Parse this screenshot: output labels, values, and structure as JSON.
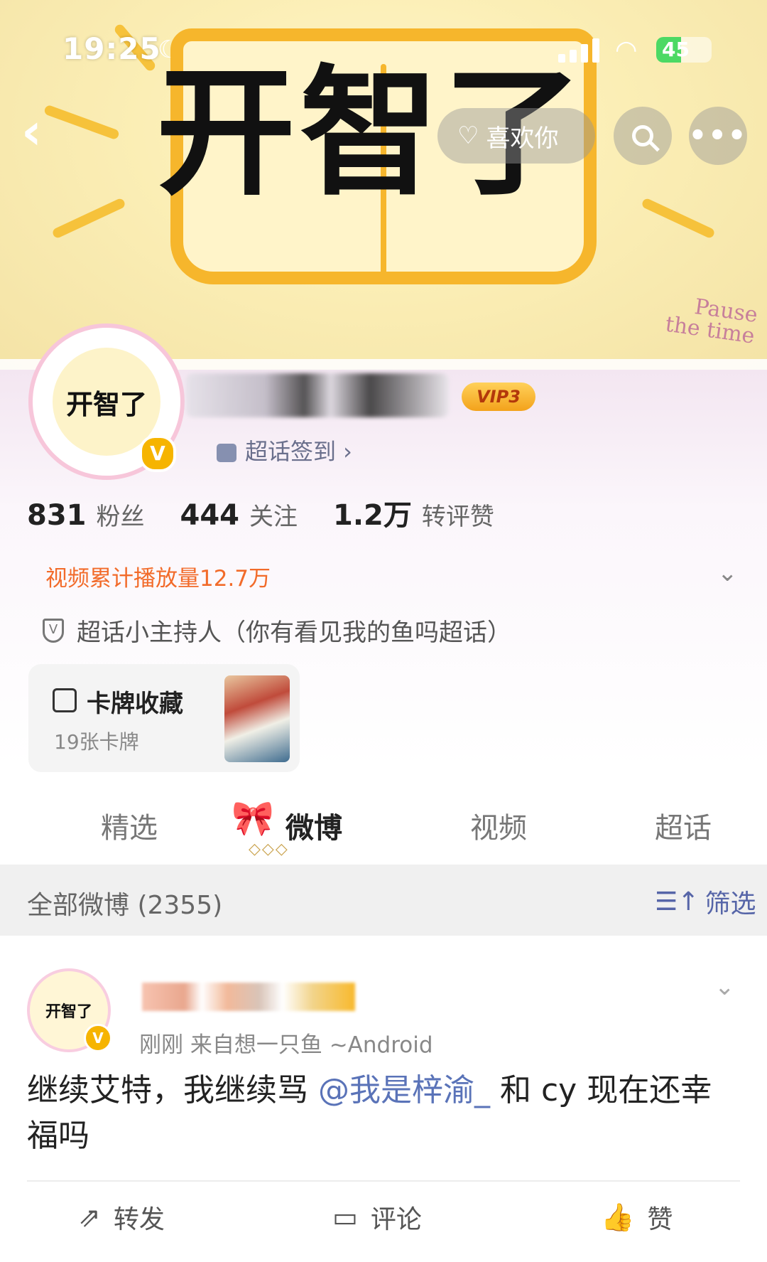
{
  "status_bar": {
    "time": "19:25",
    "battery": "45",
    "battery_level": 0.45
  },
  "banner": {
    "title": "开智了",
    "decoration_text": "Pause the time"
  },
  "nav": {
    "back_icon": "chevron-left-icon",
    "like_label": "喜欢你",
    "search_icon": "search-icon",
    "more_label": "•••"
  },
  "profile": {
    "avatar_text": "开智了",
    "vip_label": "VIP3",
    "checkin_label": "超话签到 ›",
    "stats": [
      {
        "num": "831",
        "label": "粉丝"
      },
      {
        "num": "444",
        "label": "关注"
      },
      {
        "num": "1.2万",
        "label": "转评赞"
      }
    ],
    "video_plays": "视频累计播放量12.7万",
    "host_label": "超话小主持人（你有看见我的鱼吗超话）",
    "host_icon_glyph": "V",
    "verify_glyph": "V"
  },
  "card_collection": {
    "title": "卡牌收藏",
    "count": "19张卡牌"
  },
  "tabs": [
    "精选",
    "微博",
    "视频",
    "超话"
  ],
  "active_tab": 1,
  "filter": {
    "count_label": "全部微博 (2355)",
    "button_label": "筛选"
  },
  "post": {
    "avatar_text": "开智了",
    "meta": "刚刚  来自想一只鱼 ~Android",
    "text_before": "继续艾特，我继续骂 ",
    "mention": "@我是梓渝_",
    "text_after": " 和 cy 现在还幸福吗",
    "actions": [
      {
        "icon": "share-icon",
        "label": "转发"
      },
      {
        "icon": "comment-icon",
        "label": "评论"
      },
      {
        "icon": "thumbs-up-icon",
        "label": "赞"
      }
    ]
  },
  "colors": {
    "accent": "#f26b2a",
    "link": "#5a73b8",
    "vip_gold": "#f3a21b"
  }
}
